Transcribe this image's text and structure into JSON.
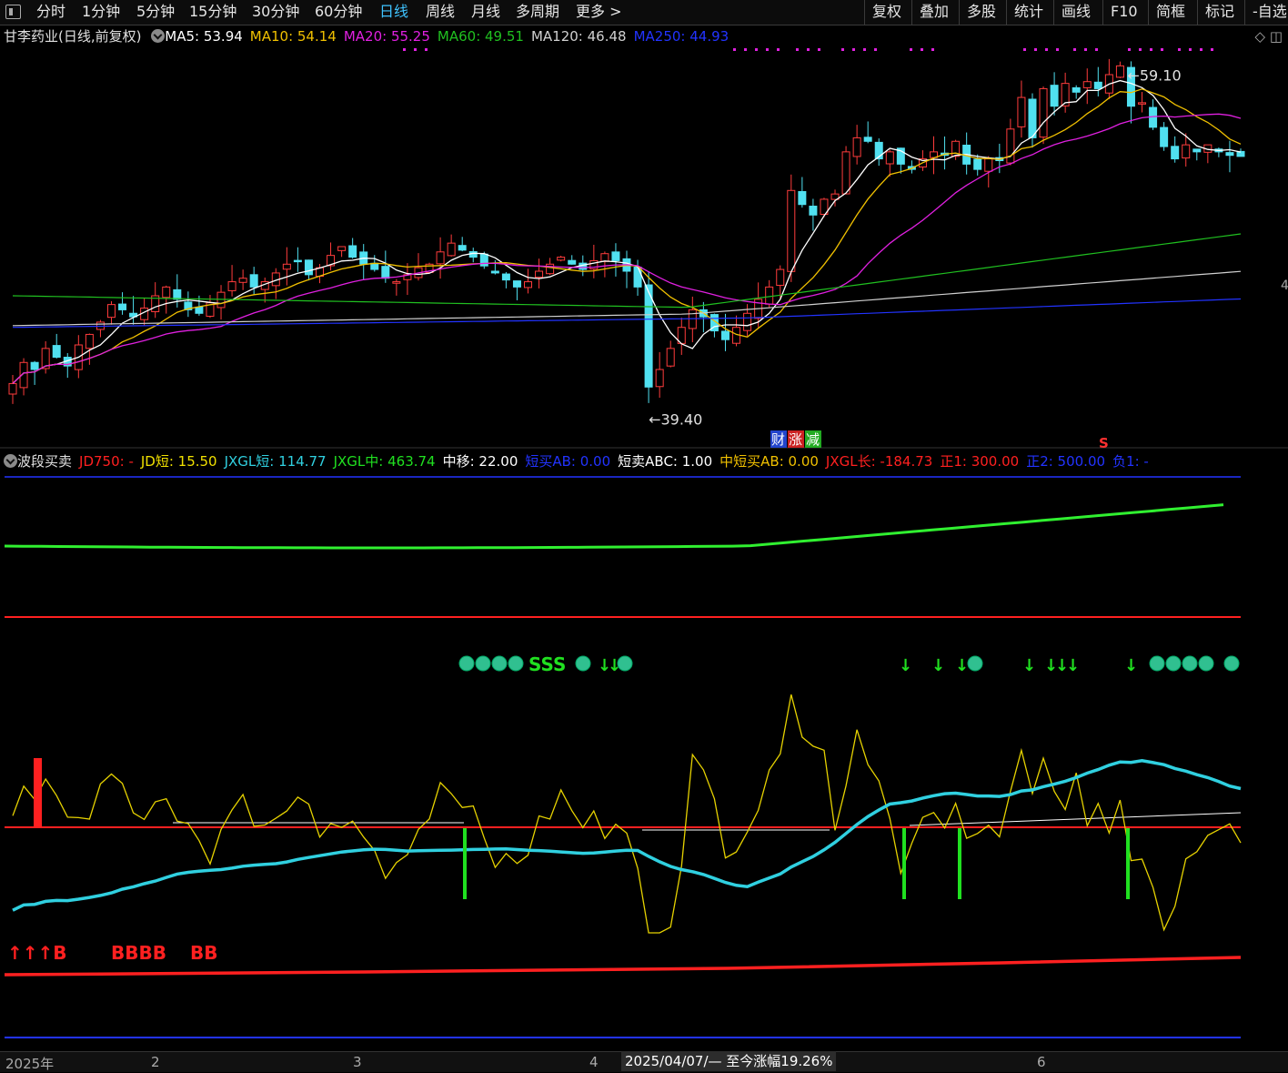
{
  "toolbar": {
    "menu_icon": "menu-icon",
    "periods": [
      "分时",
      "1分钟",
      "5分钟",
      "15分钟",
      "30分钟",
      "60分钟",
      "日线",
      "周线",
      "月线",
      "多周期",
      "更多 >"
    ],
    "active_period": "日线",
    "tools": [
      "复权",
      "叠加",
      "多股",
      "统计",
      "画线",
      "F10",
      "简框",
      "标记",
      "-自选"
    ]
  },
  "main_chart": {
    "stock_title": "甘李药业(日线,前复权)",
    "ma": [
      {
        "label": "MA5: 53.94",
        "color": "#ffffff"
      },
      {
        "label": "MA10: 54.14",
        "color": "#f0c000"
      },
      {
        "label": "MA20: 55.25",
        "color": "#e020e0"
      },
      {
        "label": "MA60: 49.51",
        "color": "#20c020"
      },
      {
        "label": "MA120: 46.48",
        "color": "#d0d0d0"
      },
      {
        "label": "MA250: 44.93",
        "color": "#2233ff"
      }
    ],
    "high_label": "59.10",
    "low_label": "39.40",
    "event_tags": [
      {
        "text": "财",
        "bg": "#2244cc"
      },
      {
        "text": "涨",
        "bg": "#cc2222"
      },
      {
        "text": "减",
        "bg": "#22aa22"
      }
    ],
    "s_marker": "S",
    "right_edge_label": "4"
  },
  "indicator": {
    "name": "波段买卖",
    "values": [
      {
        "label": "JD750: -",
        "color": "#ff2020"
      },
      {
        "label": "JD短: 15.50",
        "color": "#f0e000"
      },
      {
        "label": "JXGL短: 114.77",
        "color": "#30d0e0"
      },
      {
        "label": "JXGL中: 463.74",
        "color": "#20e020"
      },
      {
        "label": "中移: 22.00",
        "color": "#ffffff"
      },
      {
        "label": "短买AB: 0.00",
        "color": "#2233ff"
      },
      {
        "label": "短卖ABC: 1.00",
        "color": "#ffffff"
      },
      {
        "label": "中短买AB: 0.00",
        "color": "#f0c000"
      },
      {
        "label": "JXGL长: -184.73",
        "color": "#ff2020"
      },
      {
        "label": "正1: 300.00",
        "color": "#ff2020"
      },
      {
        "label": "正2: 500.00",
        "color": "#2233ff"
      },
      {
        "label": "负1: -",
        "color": "#2233ff"
      }
    ],
    "buy_labels": [
      "↑↑↑B",
      "BBBB",
      "BB"
    ],
    "sell_labels": [
      "SSS"
    ],
    "sell_arrow_text": "↓"
  },
  "date_axis": {
    "labels": [
      "2025年",
      "2",
      "3",
      "4",
      "6"
    ],
    "tooltip": "2025/04/07/— 至今涨幅19.26%"
  },
  "chart_data": {
    "type": "candlestick",
    "x_range": [
      "2025-01",
      "2025-06"
    ],
    "y_range": [
      39.0,
      60.0
    ],
    "close": [
      41.0,
      42.2,
      41.8,
      43.0,
      42.5,
      42.0,
      43.2,
      43.8,
      44.5,
      45.5,
      45.2,
      44.8,
      45.3,
      46.0,
      46.5,
      45.8,
      45.2,
      45.0,
      45.6,
      46.2,
      46.8,
      47.0,
      46.5,
      46.8,
      47.3,
      47.8,
      48.0,
      47.2,
      47.6,
      48.3,
      48.8,
      48.2,
      47.8,
      47.5,
      47.0,
      46.8,
      47.2,
      47.6,
      47.8,
      48.5,
      49.0,
      48.6,
      48.2,
      47.7,
      47.3,
      46.9,
      46.5,
      46.8,
      47.4,
      47.8,
      48.2,
      47.8,
      47.5,
      48.0,
      48.4,
      48.0,
      47.4,
      46.5,
      40.8,
      41.8,
      43.0,
      44.2,
      45.2,
      44.8,
      44.0,
      43.5,
      44.2,
      45.0,
      45.8,
      46.5,
      47.5,
      52.0,
      51.2,
      50.6,
      51.5,
      51.8,
      54.2,
      55.0,
      54.8,
      53.8,
      54.2,
      53.5,
      53.2,
      53.8,
      54.2,
      54.0,
      54.8,
      53.5,
      53.2,
      53.8,
      53.7,
      55.5,
      57.3,
      55.0,
      57.8,
      56.8,
      58.1,
      57.6,
      58.2,
      57.8,
      58.6,
      59.1,
      56.8,
      57.0,
      55.6,
      54.5,
      53.8,
      54.6,
      54.2,
      54.6,
      54.2,
      54.0,
      53.94
    ]
  }
}
